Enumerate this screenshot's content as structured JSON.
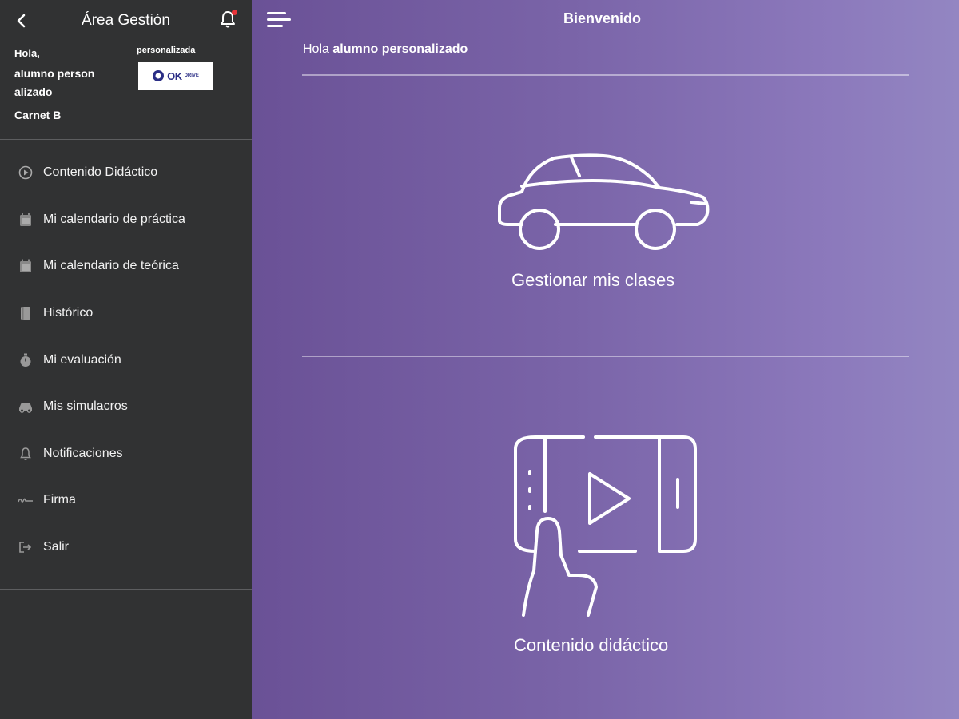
{
  "sidebar": {
    "title": "Área Gestión",
    "greeting": "Hola,",
    "user_name": "alumno person alizado",
    "license": "Carnet B",
    "logo_caption": "personalizada",
    "logo_text": "OK",
    "logo_small": "DRIVE",
    "menu": [
      {
        "label": "Contenido Didáctico",
        "icon": "play-circle-icon"
      },
      {
        "label": "Mi calendario de práctica",
        "icon": "calendar-icon"
      },
      {
        "label": "Mi calendario de teórica",
        "icon": "calendar-icon"
      },
      {
        "label": "Histórico",
        "icon": "book-icon"
      },
      {
        "label": "Mi evaluación",
        "icon": "stopwatch-icon"
      },
      {
        "label": "Mis simulacros",
        "icon": "car-icon"
      },
      {
        "label": "Notificaciones",
        "icon": "bell-icon"
      },
      {
        "label": "Firma",
        "icon": "signature-icon"
      },
      {
        "label": "Salir",
        "icon": "logout-icon"
      }
    ],
    "notification_dot_color": "#e8343a"
  },
  "main": {
    "title": "Bienvenido",
    "greeting_prefix": "Hola",
    "greeting_name": "alumno personalizado",
    "cards": [
      {
        "label": "Gestionar mis clases",
        "icon": "car-outline-icon"
      },
      {
        "label": "Contenido didáctico",
        "icon": "tablet-video-icon"
      }
    ],
    "accent_gradient": [
      "#6a5196",
      "#9386c2"
    ]
  }
}
